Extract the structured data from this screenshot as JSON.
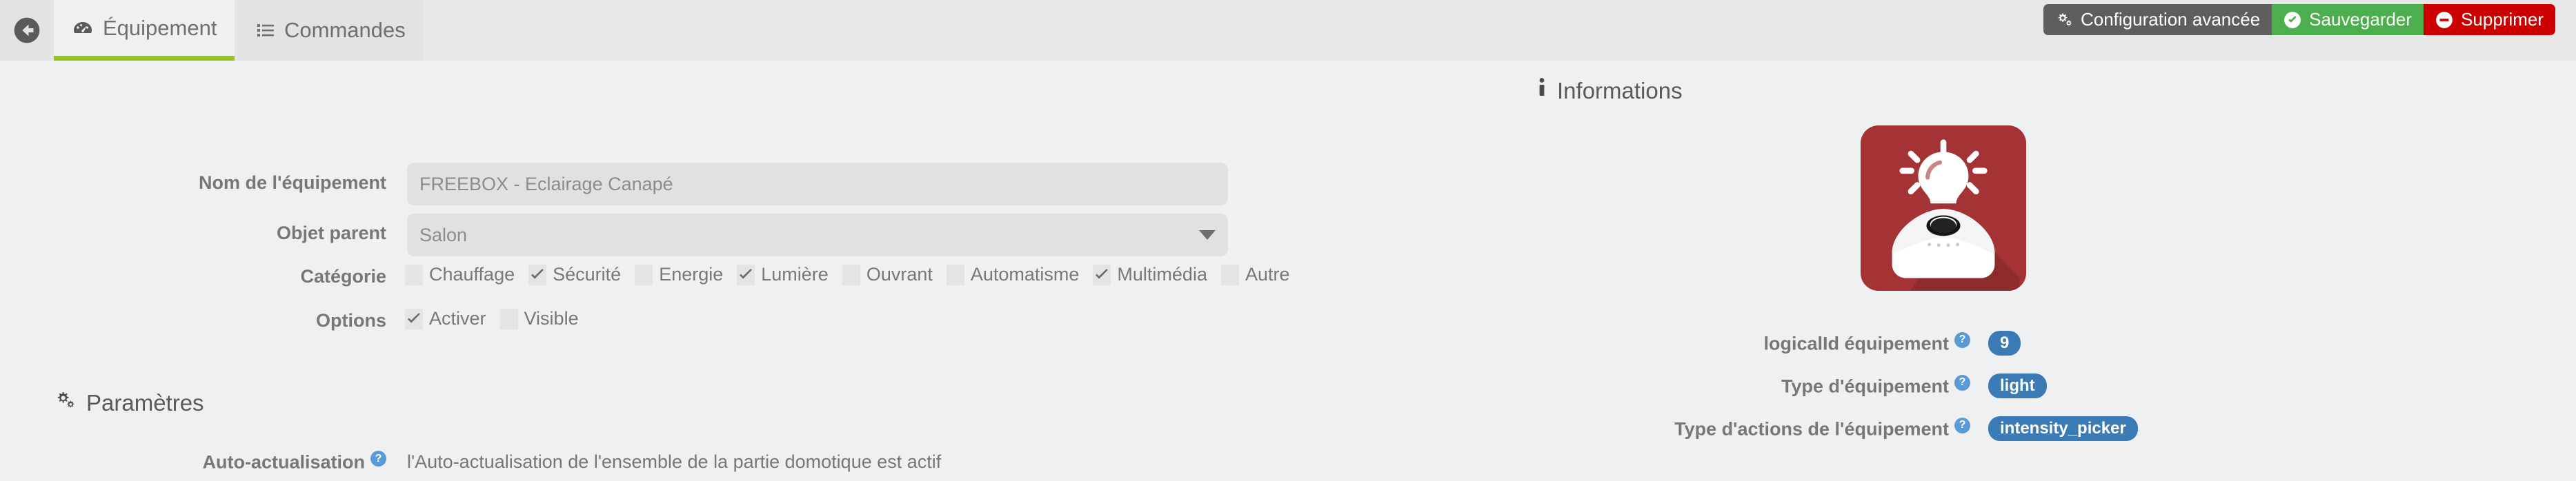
{
  "header": {
    "back_icon": "arrow-circle-left-icon",
    "tabs": [
      {
        "label": "Équipement",
        "icon": "dashboard-icon",
        "active": true
      },
      {
        "label": "Commandes",
        "icon": "list-icon",
        "active": false
      }
    ],
    "actions": [
      {
        "label": "Configuration avancée",
        "icon": "cogs-icon",
        "color": "#5e5e5e"
      },
      {
        "label": "Sauvegarder",
        "icon": "check-circle-icon",
        "color": "#4cae4c"
      },
      {
        "label": "Supprimer",
        "icon": "minus-circle-icon",
        "color": "#cc0000"
      }
    ]
  },
  "form": {
    "name_label": "Nom de l'équipement",
    "name_value": "FREEBOX - Eclairage Canapé",
    "parent_label": "Objet parent",
    "parent_value": "Salon",
    "category_label": "Catégorie",
    "categories": [
      {
        "label": "Chauffage",
        "checked": false
      },
      {
        "label": "Sécurité",
        "checked": true
      },
      {
        "label": "Energie",
        "checked": false
      },
      {
        "label": "Lumière",
        "checked": true
      },
      {
        "label": "Ouvrant",
        "checked": false
      },
      {
        "label": "Automatisme",
        "checked": false
      },
      {
        "label": "Multimédia",
        "checked": true
      },
      {
        "label": "Autre",
        "checked": false
      }
    ],
    "options_label": "Options",
    "options": [
      {
        "label": "Activer",
        "checked": true
      },
      {
        "label": "Visible",
        "checked": false
      }
    ]
  },
  "parameters": {
    "section_title": "Paramètres",
    "section_icon": "cogs-icon",
    "auto_refresh_label": "Auto-actualisation",
    "auto_refresh_help": "?",
    "auto_refresh_value": "l'Auto-actualisation de l'ensemble de la partie domotique est actif"
  },
  "informations": {
    "section_title": "Informations",
    "section_icon": "info-icon",
    "device_image_alt": "light-bulb-device-icon",
    "rows": [
      {
        "label": "logicalId équipement",
        "help": "?",
        "badge": "9"
      },
      {
        "label": "Type d'équipement",
        "help": "?",
        "badge": "light"
      },
      {
        "label": "Type d'actions de l'équipement",
        "help": "?",
        "badge": "intensity_picker"
      }
    ]
  },
  "colors": {
    "accent_green": "#98c21d",
    "badge_blue": "#3a7ab5",
    "save_green": "#4cae4c",
    "delete_red": "#cc0000",
    "device_red": "#a33334",
    "page_bg": "#eff0f2",
    "tabbar_bg": "#e7e7e7",
    "field_bg": "#e0e1e1"
  }
}
